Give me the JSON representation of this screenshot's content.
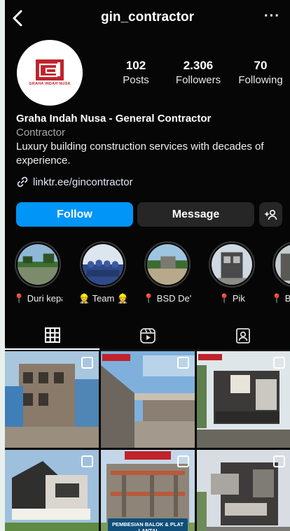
{
  "header": {
    "username": "gin_contractor",
    "more": "···"
  },
  "profile": {
    "logo_text": "GRAHA INDAH NUSA",
    "stats": [
      {
        "value": "102",
        "label": "Posts"
      },
      {
        "value": "2.306",
        "label": "Followers"
      },
      {
        "value": "70",
        "label": "Following"
      }
    ],
    "name": "Graha Indah Nusa - General Contractor",
    "category": "Contractor",
    "description": "Luxury building construction services with decades of experience.",
    "link": "linktr.ee/gincontractor"
  },
  "actions": {
    "follow": "Follow",
    "message": "Message"
  },
  "highlights": [
    {
      "label": "📍 Duri kepa"
    },
    {
      "label": "👷 Team 👷"
    },
    {
      "label": "📍 BSD De'..."
    },
    {
      "label": "📍 Pik"
    },
    {
      "label": "📍 BS"
    }
  ],
  "tabs": [
    {
      "name": "posts-grid-icon"
    },
    {
      "name": "reels-icon"
    },
    {
      "name": "tagged-icon"
    }
  ],
  "posts": [
    {
      "icon": "multi-photo-icon"
    },
    {
      "icon": "multi-photo-icon"
    },
    {
      "icon": "multi-photo-icon"
    },
    {
      "icon": "multi-photo-icon"
    },
    {
      "icon": "multi-photo-icon",
      "banner": "PEMBESIAN BALOK & PLAT LANTAI"
    },
    {
      "icon": "multi-photo-icon"
    }
  ],
  "colors": {
    "accent": "#0095f6",
    "background": "#060606",
    "button_dark": "#262626",
    "brand_red": "#c0232b"
  }
}
